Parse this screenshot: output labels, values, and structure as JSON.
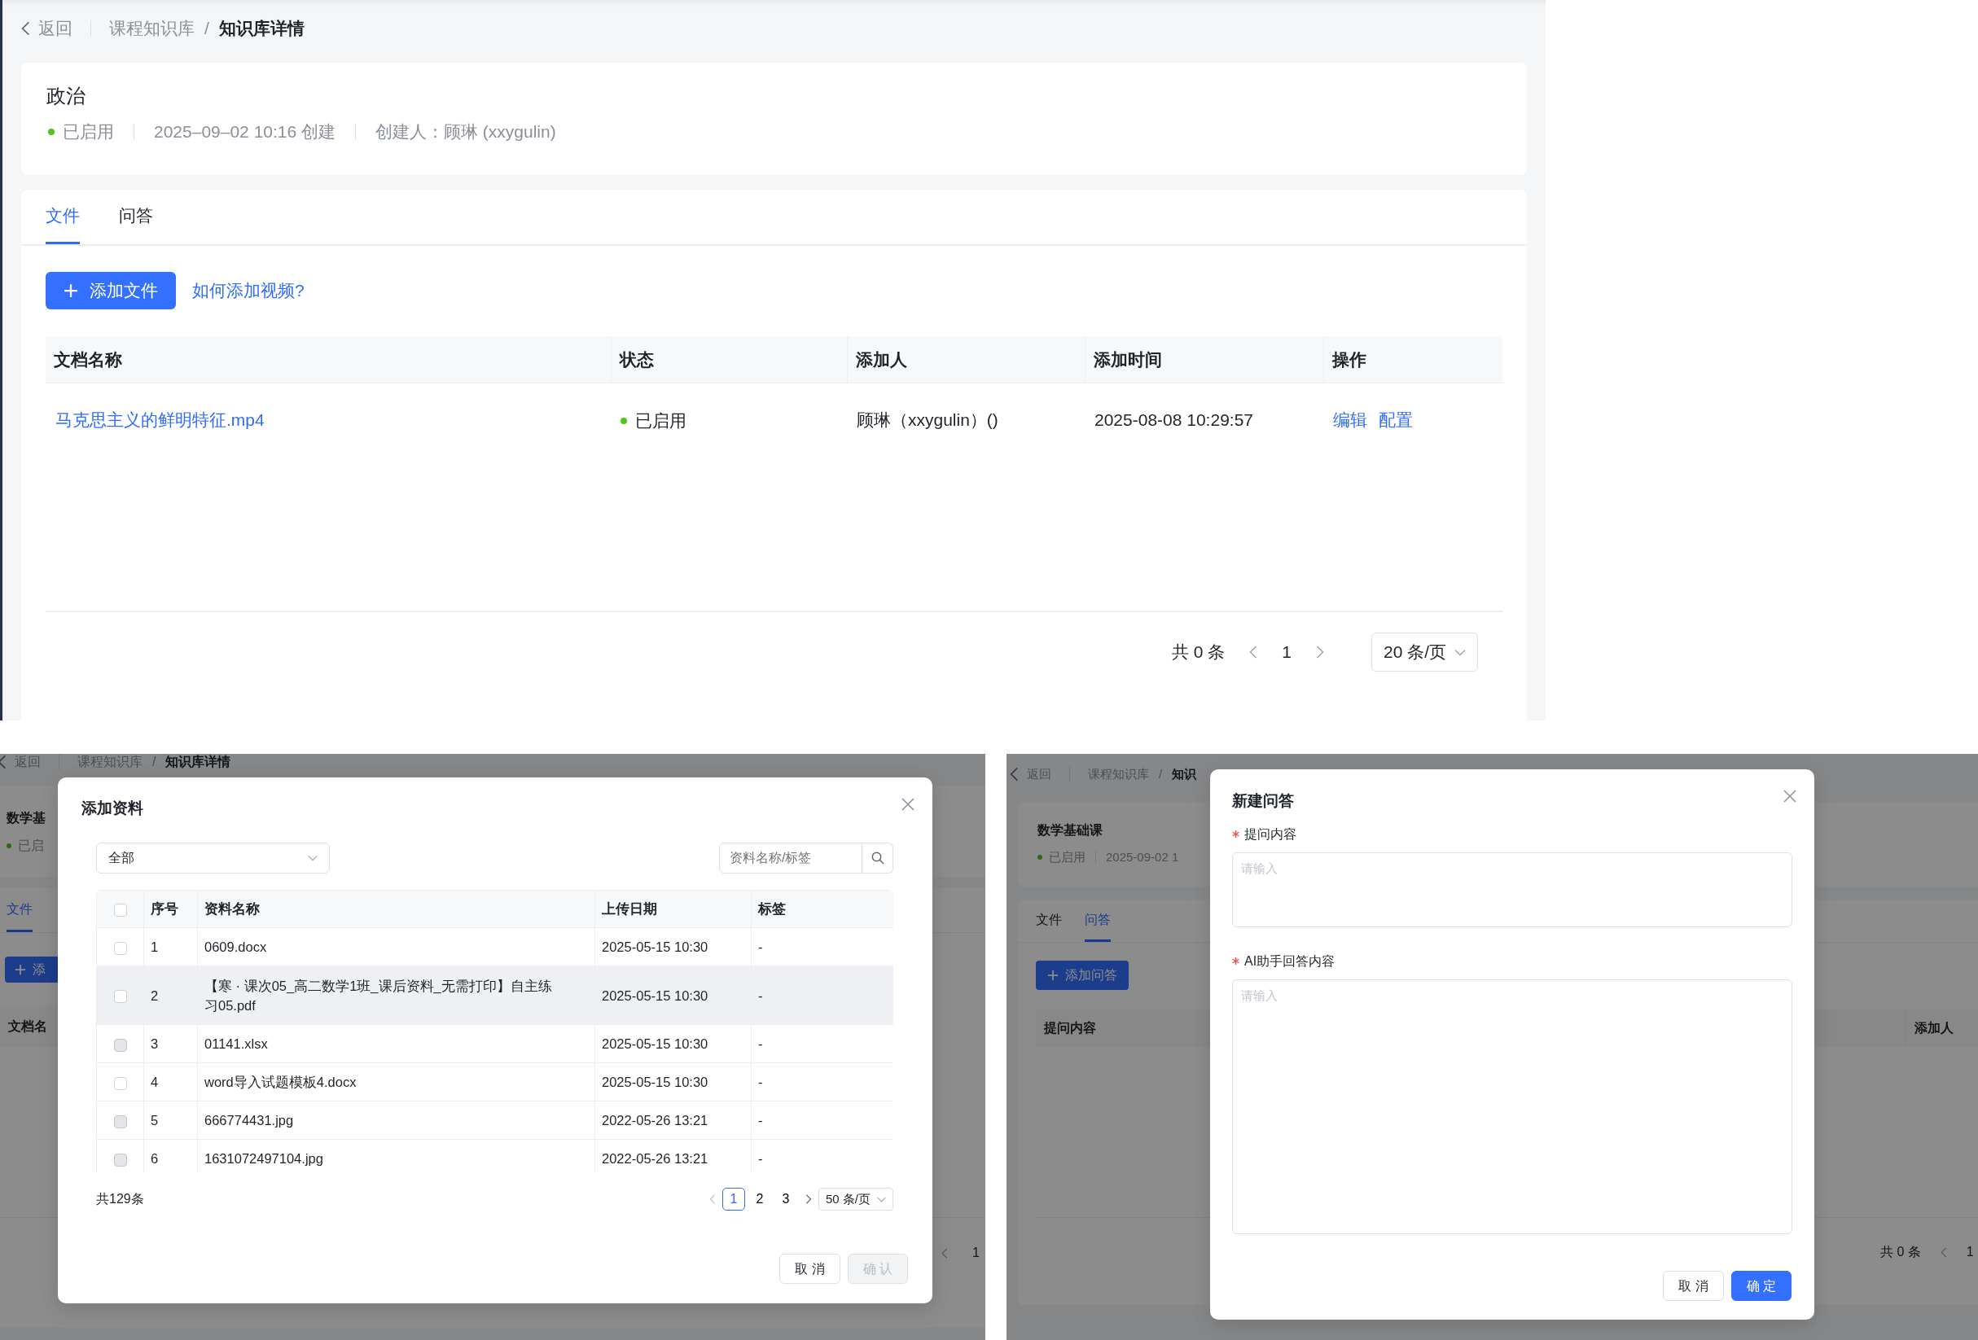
{
  "main_page": {
    "breadcrumb": {
      "back": "返回",
      "trail": [
        "课程知识库"
      ],
      "separator": "/",
      "current": "知识库详情"
    },
    "title": "政治",
    "status": "已启用",
    "created": "2025–09–02 10:16 创建",
    "creator": "创建人：顾琳 (xxygulin)",
    "tabs": [
      {
        "label": "文件",
        "selected": true
      },
      {
        "label": "问答",
        "selected": false
      }
    ],
    "add_button": "添加文件",
    "help_link": "如何添加视频?",
    "table": {
      "columns": [
        "文档名称",
        "状态",
        "添加人",
        "添加时间",
        "操作"
      ],
      "rows": [
        {
          "name": "马克思主义的鲜明特征.mp4",
          "status": "已启用",
          "added_by": "顾琳（xxygulin）()",
          "added_at": "2025-08-08 10:29:57",
          "actions": [
            "编辑",
            "配置"
          ]
        }
      ]
    },
    "pagination": {
      "total": "共 0 条",
      "page": "1",
      "page_size": "20 条/页"
    }
  },
  "add_resource_view": {
    "background": {
      "breadcrumb": {
        "back": "返回",
        "trail": [
          "课程知识库"
        ],
        "separator": "/",
        "current": "知识库详情"
      },
      "title": "数学基",
      "status": "已启",
      "tabs": [
        {
          "label": "文件",
          "selected": true
        }
      ],
      "add_button": "添",
      "columns": [
        "文档名"
      ],
      "page": "1"
    },
    "dialog": {
      "title": "添加资料",
      "filter": "全部",
      "search_placeholder": "资料名称/标签",
      "header_checkbox": {
        "checked": false
      },
      "columns": [
        "序号",
        "资料名称",
        "上传日期",
        "标签"
      ],
      "rows": [
        {
          "index": "1",
          "name": "0609.docx",
          "date": "2025-05-15 10:30",
          "tag": "-",
          "checked": false,
          "disabled": false,
          "highlighted": false
        },
        {
          "index": "2",
          "name": "【寒 · 课次05_高二数学1班_课后资料_无需打印】自主练习05.pdf",
          "date": "2025-05-15 10:30",
          "tag": "-",
          "checked": false,
          "disabled": false,
          "highlighted": true
        },
        {
          "index": "3",
          "name": "01141.xlsx",
          "date": "2025-05-15 10:30",
          "tag": "-",
          "checked": false,
          "disabled": true,
          "highlighted": false
        },
        {
          "index": "4",
          "name": "word导入试题模板4.docx",
          "date": "2025-05-15 10:30",
          "tag": "-",
          "checked": false,
          "disabled": false,
          "highlighted": false
        },
        {
          "index": "5",
          "name": "666774431.jpg",
          "date": "2022-05-26 13:21",
          "tag": "-",
          "checked": false,
          "disabled": true,
          "highlighted": false
        },
        {
          "index": "6",
          "name": "1631072497104.jpg",
          "date": "2022-05-26 13:21",
          "tag": "-",
          "checked": false,
          "disabled": true,
          "highlighted": false
        }
      ],
      "total": "共129条",
      "pages": [
        {
          "label": "1",
          "selected": true
        },
        {
          "label": "2",
          "selected": false
        },
        {
          "label": "3",
          "selected": false
        }
      ],
      "page_size": "50 条/页",
      "buttons": [
        {
          "label": "取 消",
          "kind": "default"
        },
        {
          "label": "确 认",
          "kind": "primary",
          "disabled": true
        }
      ]
    }
  },
  "new_qa_view": {
    "background": {
      "breadcrumb": {
        "back": "返回",
        "trail": [
          "课程知识库"
        ],
        "separator": "/",
        "current": "知识"
      },
      "title": "数学基础课",
      "status": "已启用",
      "date": "2025-09-02 1",
      "tabs": [
        {
          "label": "文件",
          "selected": false
        },
        {
          "label": "问答",
          "selected": true
        }
      ],
      "add_button": "添加问答",
      "columns": [
        "提问内容",
        "添加人"
      ],
      "total": "共 0 条",
      "page": "1"
    },
    "dialog": {
      "title": "新建问答",
      "fields": [
        {
          "label": "提问内容",
          "required": true,
          "placeholder": "请输入"
        },
        {
          "label": "AI助手回答内容",
          "required": true,
          "placeholder": "请输入"
        }
      ],
      "buttons": [
        {
          "label": "取 消",
          "kind": "default"
        },
        {
          "label": "确 定",
          "kind": "primary",
          "disabled": false
        }
      ]
    }
  }
}
